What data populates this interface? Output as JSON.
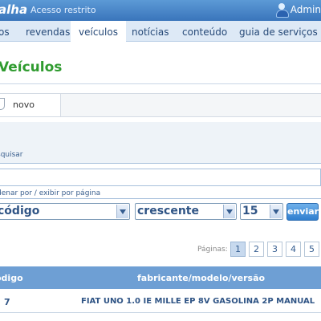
{
  "header": {
    "brand": "alha",
    "restricted_label": "Acesso restrito",
    "user_label": "Admin"
  },
  "nav": {
    "items": [
      {
        "label": "os"
      },
      {
        "label": "revendas"
      },
      {
        "label": "veículos",
        "active": true
      },
      {
        "label": "notícias"
      },
      {
        "label": "conteúdo"
      },
      {
        "label": "guia de serviços"
      }
    ]
  },
  "page": {
    "title": "Veículos"
  },
  "toolbar": {
    "new_label": "novo"
  },
  "search": {
    "link_label": "squisar",
    "input_value": ""
  },
  "sort": {
    "label": "denar por / exibir por página",
    "field_value": "código",
    "order_value": "crescente",
    "per_page_value": "15",
    "send_label": "enviar"
  },
  "pager": {
    "label": "Páginas:",
    "pages": [
      "1",
      "2",
      "3",
      "4",
      "5"
    ],
    "current": "1"
  },
  "table": {
    "headers": {
      "code": "ódigo",
      "model": "fabricante/modelo/versão"
    },
    "rows": [
      {
        "code": "7",
        "model": "FIAT UNO 1.0 IE MILLE EP 8V GASOLINA 2P MANUAL"
      }
    ]
  },
  "colors": {
    "header_blue": "#3a75bb",
    "title_green": "#2f9b2f",
    "table_head_blue": "#6e9fd4"
  }
}
